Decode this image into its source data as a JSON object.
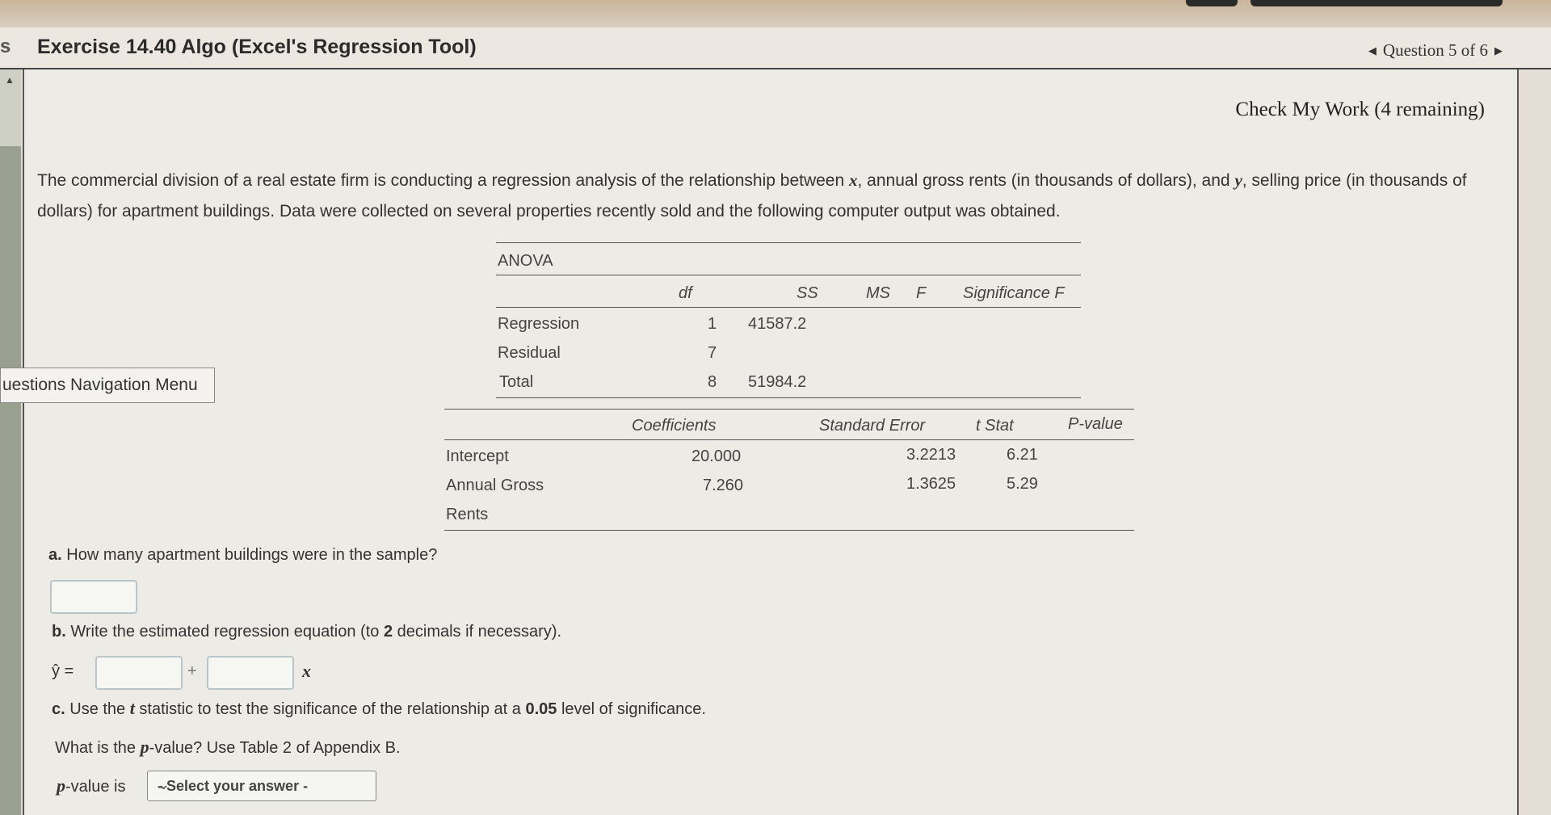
{
  "header": {
    "left_fragment": "s",
    "title": "Exercise 14.40 Algo (Excel's Regression Tool)",
    "question_nav": "Question 5 of 6"
  },
  "nav_menu": {
    "label": "uestions Navigation Menu"
  },
  "check_my_work": "Check My Work (4 remaining)",
  "intro": {
    "p1": "The commercial division of a real estate firm is conducting a regression analysis of the relationship between ",
    "x": "x",
    "p2": ", annual gross rents (in thousands of dollars), and ",
    "y": "y",
    "p3": ", selling price (in thousands of dollars) for apartment buildings. Data were collected on several properties recently sold and the following computer output was obtained."
  },
  "anova": {
    "title": "ANOVA",
    "headers": [
      "df",
      "SS",
      "MS",
      "F",
      "Significance F"
    ],
    "rows": [
      {
        "label": "Regression",
        "df": "1",
        "ss": "41587.2"
      },
      {
        "label": "Residual",
        "df": "7",
        "ss": ""
      },
      {
        "label": "Total",
        "df": "8",
        "ss": "51984.2"
      }
    ]
  },
  "coefficients": {
    "headers": [
      "Coefficients",
      "Standard Error",
      "t Stat",
      "P-value"
    ],
    "rows": [
      {
        "label": "Intercept",
        "coef": "20.000",
        "se": "3.2213",
        "t": "6.21"
      },
      {
        "label": "Annual Gross",
        "coef": "7.260",
        "se": "1.3625",
        "t": "5.29"
      },
      {
        "label": "Rents",
        "coef": "",
        "se": "",
        "t": ""
      }
    ]
  },
  "questions": {
    "a": {
      "letter": "a.",
      "text": "How many apartment buildings were in the sample?"
    },
    "b": {
      "letter": "b.",
      "text_pre": "Write the estimated regression equation (to ",
      "num": "2",
      "text_post": " decimals if necessary).",
      "yhat": "ŷ =",
      "plus": "+",
      "x": "x"
    },
    "c": {
      "letter": "c.",
      "pre": "Use the ",
      "t": "t",
      "post": " statistic to test the significance of the relationship at a ",
      "level": "0.05",
      "post2": " level of significance."
    },
    "pvalue_q": {
      "pre": "What is the ",
      "p": "p",
      "post": "-value? Use Table 2 of Appendix B."
    },
    "pvalue_label": {
      "p": "p",
      "post": "-value is"
    },
    "select": {
      "selected": "- Select your answer -"
    }
  }
}
